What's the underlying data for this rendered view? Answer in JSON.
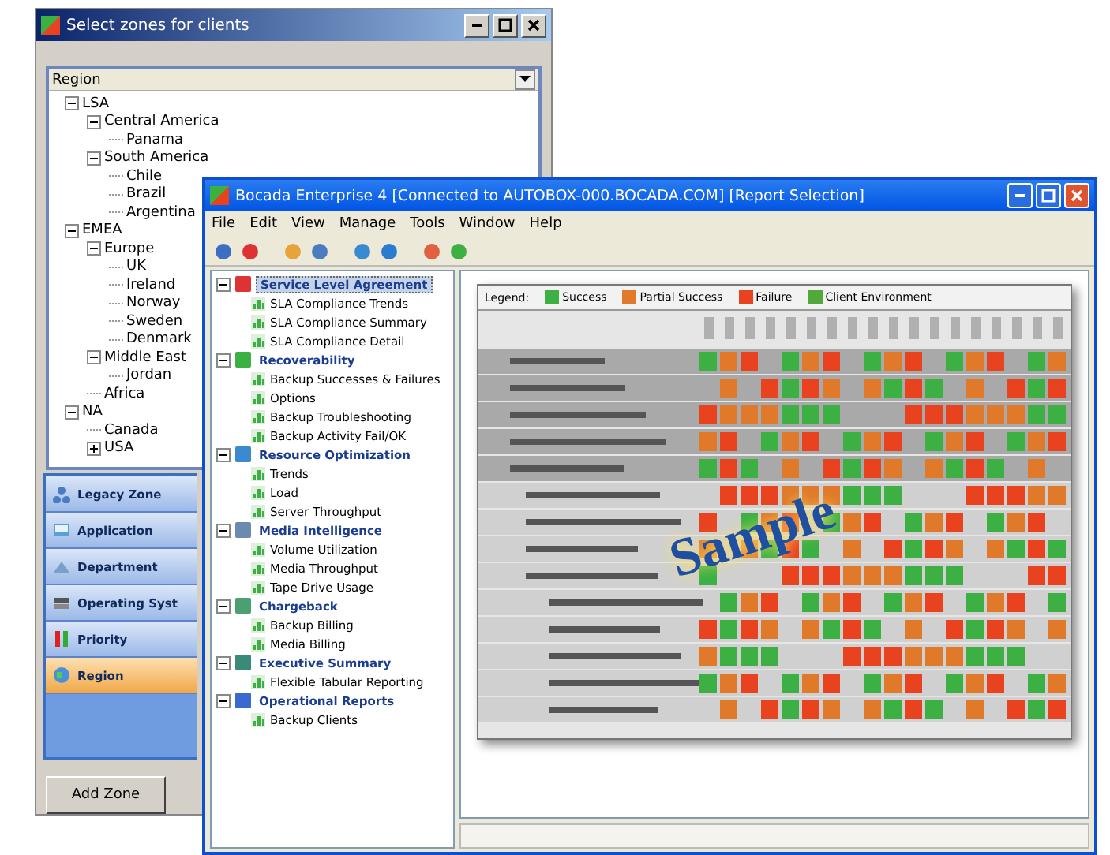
{
  "zone_window": {
    "title": "Select zones for clients",
    "tree_header": "Region",
    "tree": [
      {
        "label": "LSA",
        "expanded": true,
        "children": [
          {
            "label": "Central America",
            "expanded": true,
            "children": [
              {
                "label": "Panama"
              }
            ]
          },
          {
            "label": "South America",
            "expanded": true,
            "children": [
              {
                "label": "Chile"
              },
              {
                "label": "Brazil"
              },
              {
                "label": "Argentina"
              }
            ]
          }
        ]
      },
      {
        "label": "EMEA",
        "expanded": true,
        "children": [
          {
            "label": "Europe",
            "expanded": true,
            "children": [
              {
                "label": "UK"
              },
              {
                "label": "Ireland"
              },
              {
                "label": "Norway"
              },
              {
                "label": "Sweden"
              },
              {
                "label": "Denmark"
              }
            ]
          },
          {
            "label": "Middle East",
            "expanded": true,
            "children": [
              {
                "label": "Jordan"
              }
            ]
          },
          {
            "label": "Africa"
          }
        ]
      },
      {
        "label": "NA",
        "expanded": true,
        "children": [
          {
            "label": "Canada"
          },
          {
            "label": "USA",
            "expanded": false
          }
        ]
      }
    ],
    "categories": [
      {
        "label": "Legacy Zone",
        "selected": false
      },
      {
        "label": "Application",
        "selected": false
      },
      {
        "label": "Department",
        "selected": false
      },
      {
        "label": "Operating Syst",
        "selected": false
      },
      {
        "label": "Priority",
        "selected": false
      },
      {
        "label": "Region",
        "selected": true
      }
    ],
    "buttons": [
      "Add Zone"
    ]
  },
  "main_window": {
    "title": "Bocada Enterprise 4 [Connected to AUTOBOX-000.BOCADA.COM]   [Report Selection]",
    "menu": [
      "File",
      "Edit",
      "View",
      "Manage",
      "Tools",
      "Window",
      "Help"
    ],
    "reports": [
      {
        "label": "Service Level Agreement",
        "selected": true,
        "children": [
          {
            "label": "SLA Compliance Trends"
          },
          {
            "label": "SLA Compliance Summary"
          },
          {
            "label": "SLA Compliance Detail"
          }
        ]
      },
      {
        "label": "Recoverability",
        "selected": false,
        "children": [
          {
            "label": "Backup Successes & Failures"
          },
          {
            "label": "Options"
          },
          {
            "label": "Backup Troubleshooting"
          },
          {
            "label": "Backup Activity Fail/OK"
          }
        ]
      },
      {
        "label": "Resource Optimization",
        "selected": false,
        "children": [
          {
            "label": "Trends"
          },
          {
            "label": "Load"
          },
          {
            "label": "Server Throughput"
          }
        ]
      },
      {
        "label": "Media Intelligence",
        "selected": false,
        "children": [
          {
            "label": "Volume Utilization"
          },
          {
            "label": "Media Throughput"
          },
          {
            "label": "Tape Drive Usage"
          }
        ]
      },
      {
        "label": "Chargeback",
        "selected": false,
        "children": [
          {
            "label": "Backup Billing"
          },
          {
            "label": "Media Billing"
          }
        ]
      },
      {
        "label": "Executive Summary",
        "selected": false,
        "children": [
          {
            "label": "Flexible Tabular Reporting"
          }
        ]
      },
      {
        "label": "Operational Reports",
        "selected": false,
        "children": [
          {
            "label": "Backup Clients"
          }
        ]
      }
    ],
    "preview": {
      "legend_title": "Legend:",
      "legend": [
        {
          "label": "Success",
          "color": "#3cb043"
        },
        {
          "label": "Partial Success",
          "color": "#e07a2a"
        },
        {
          "label": "Failure",
          "color": "#e8431e"
        },
        {
          "label": "Client Environment",
          "color": "#52a83a"
        }
      ],
      "stamp": "Sample"
    }
  }
}
